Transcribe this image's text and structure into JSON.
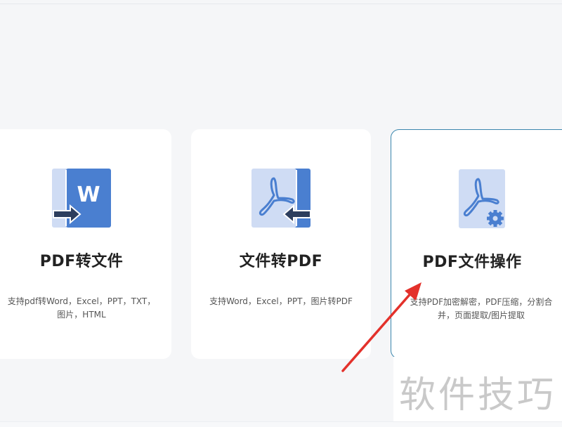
{
  "cards": [
    {
      "title": "PDF转文件",
      "description": "支持pdf转Word，Excel，PPT，TXT，图片，HTML",
      "icon": "pdf-to-word-icon",
      "icon_letter": "W"
    },
    {
      "title": "文件转PDF",
      "description": "支持Word，Excel，PPT，图片转PDF",
      "icon": "file-to-pdf-icon"
    },
    {
      "title": "PDF文件操作",
      "description": "支持PDF加密解密，PDF压缩，分割合并，页面提取/图片提取",
      "icon": "pdf-settings-icon",
      "selected": true
    }
  ],
  "watermark": {
    "text": "软件技巧"
  },
  "annotation": {
    "icon": "red-arrow-annotation"
  },
  "colors": {
    "background": "#f5f6f8",
    "card": "#ffffff",
    "icon_dark": "#4a7fd0",
    "icon_light": "#cfdcf4",
    "selected_border": "#3a86ad",
    "arrow": "#e3312b",
    "watermark": "#c9c9c9"
  }
}
